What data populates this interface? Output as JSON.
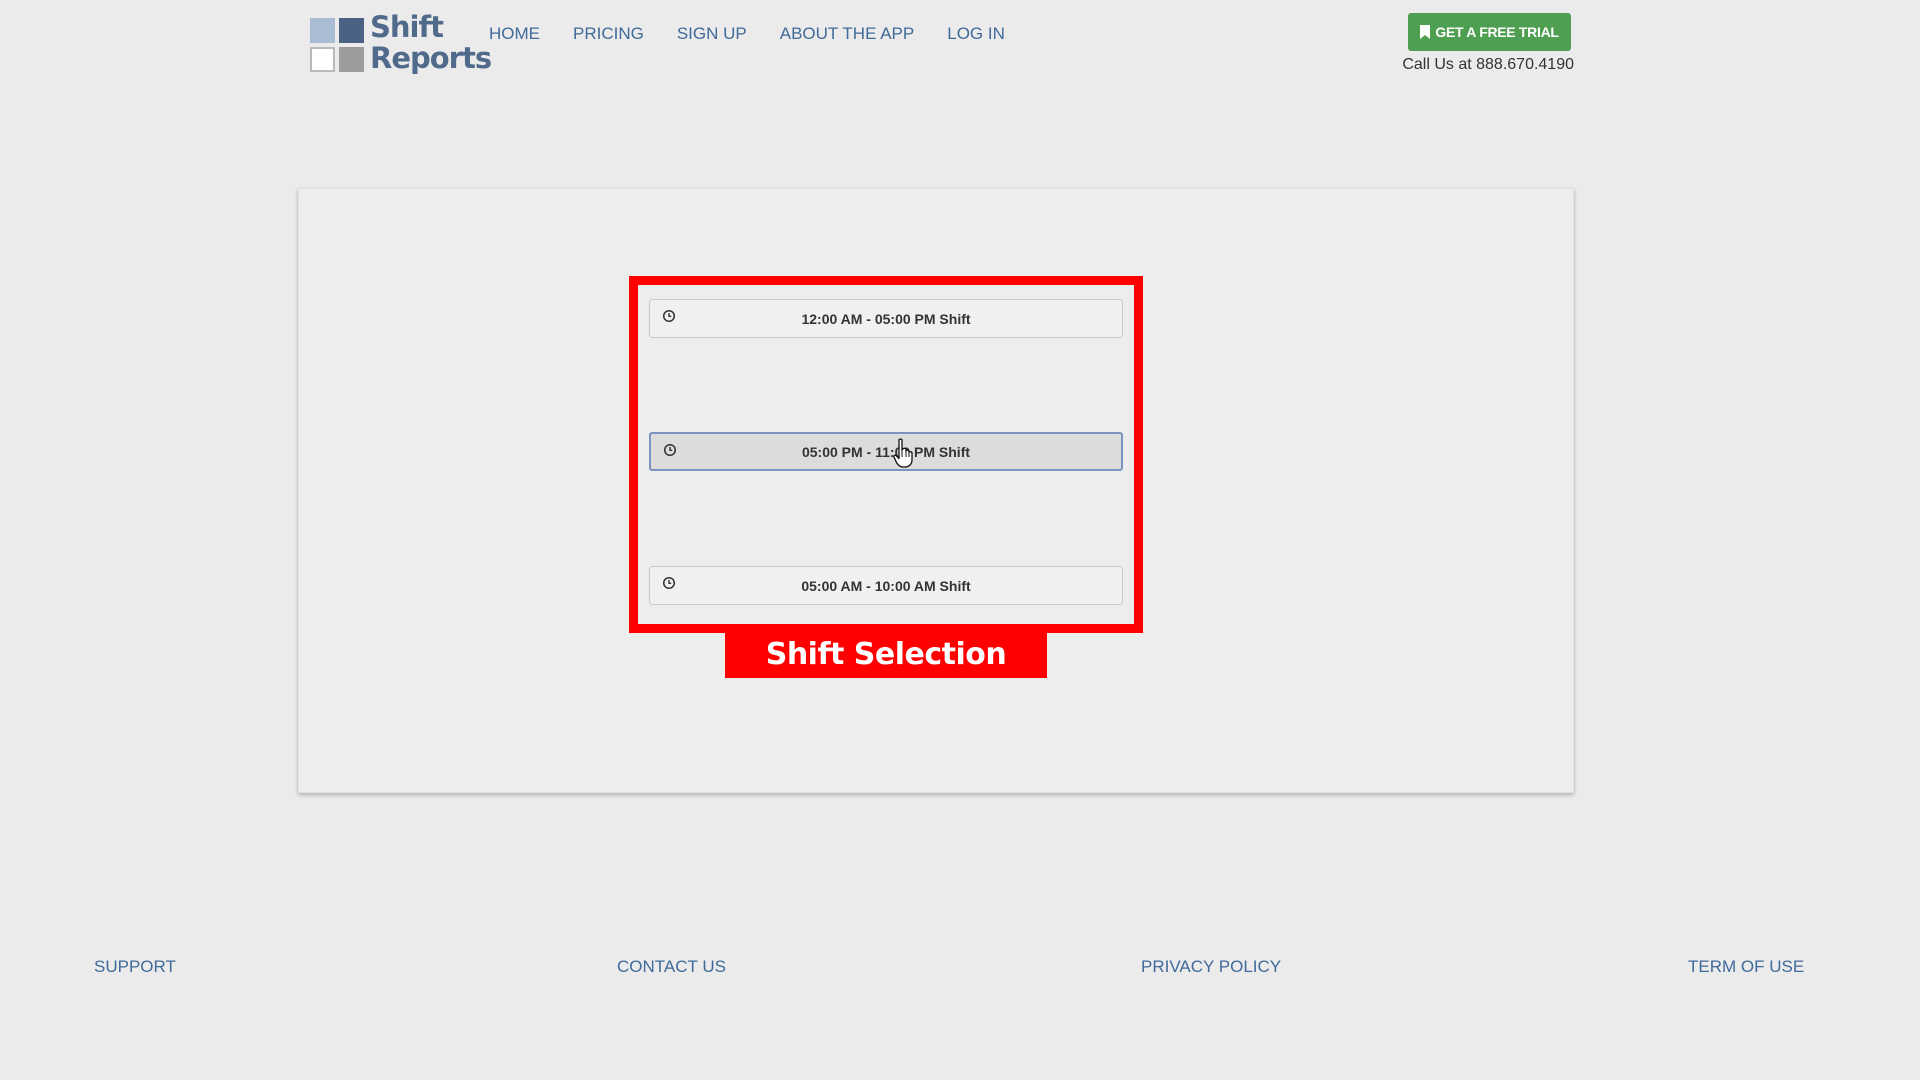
{
  "header": {
    "logo": {
      "line1": "Shift",
      "line2": "Reports"
    },
    "nav": [
      {
        "label": "HOME"
      },
      {
        "label": "PRICING"
      },
      {
        "label": "SIGN UP"
      },
      {
        "label": "ABOUT THE APP"
      },
      {
        "label": "LOG IN"
      }
    ],
    "trial_button": "GET A FREE TRIAL",
    "phone_text": "Call Us at 888.670.4190"
  },
  "shifts": [
    {
      "label": "12:00 AM - 05:00 PM Shift",
      "selected": false
    },
    {
      "label": "05:00 PM - 11:00 PM Shift",
      "selected": true
    },
    {
      "label": "05:00 AM - 10:00 AM Shift",
      "selected": false
    }
  ],
  "annotation": {
    "label": "Shift Selection",
    "color": "#ff0000"
  },
  "footer": {
    "links": [
      {
        "label": "SUPPORT"
      },
      {
        "label": "CONTACT US"
      },
      {
        "label": "PRIVACY POLICY"
      },
      {
        "label": "TERM OF USE"
      }
    ]
  },
  "colors": {
    "accent_green": "#4f9f52",
    "link_blue": "#3f6a9a",
    "background": "#ebebeb"
  },
  "icons": {
    "shift_icon": "clock-icon",
    "trial_icon": "bookmark-icon",
    "pointer": "hand-cursor-icon"
  }
}
